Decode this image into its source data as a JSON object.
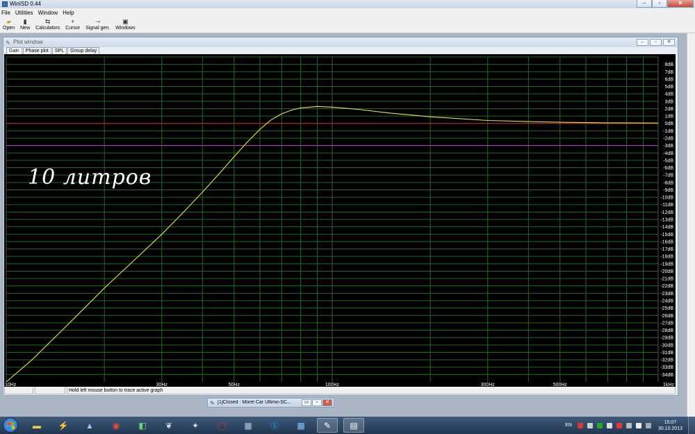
{
  "app": {
    "title": "WinISD 0.44"
  },
  "menu": [
    "File",
    "Utilities",
    "Window",
    "Help"
  ],
  "toolbar": [
    {
      "icon": "open-icon",
      "label": "Open"
    },
    {
      "icon": "new-icon",
      "label": "New"
    },
    {
      "icon": "calculators-icon",
      "label": "Calculators"
    },
    {
      "icon": "cursor-icon",
      "label": "Cursor"
    },
    {
      "icon": "signal-gen-icon",
      "label": "Signal gen."
    },
    {
      "icon": "windows-icon",
      "label": "Windows"
    }
  ],
  "plot_window": {
    "title": "Plot window",
    "tabs": [
      "Gain",
      "Phase plot",
      "SPL",
      "Group delay"
    ],
    "active_tab": "Gain",
    "annotation": "10 литров",
    "status": "Hold left mouse button to trace active graph"
  },
  "minimized_window": {
    "title": "[1]Closed : Morel Car Ultimo-SC..."
  },
  "taskbar": {
    "icons": [
      "explorer",
      "winamp",
      "xilisoft",
      "chrome",
      "corel",
      "bird",
      "fox",
      "opera",
      "installer",
      "skype",
      "controlpanel",
      "winisd",
      "props"
    ],
    "active_icon": "winisd",
    "language": "EN",
    "time": "15:07",
    "date": "30.10.2013"
  },
  "colors": {
    "grid_green": "#1f6a1f",
    "grid_gray": "#555555",
    "curve": "#e6e64a",
    "zero_line": "#d02020",
    "minus3_line": "#b040c0",
    "tick_text": "#ffffff"
  },
  "chart_data": {
    "type": "line",
    "title": "",
    "xlabel": "",
    "ylabel": "",
    "x_scale": "log",
    "xlim": [
      10,
      1000
    ],
    "ylim": [
      -35,
      9
    ],
    "grid": true,
    "x_tick_labels": [
      {
        "x": 10,
        "label": "10Hz"
      },
      {
        "x": 30,
        "label": "30Hz"
      },
      {
        "x": 50,
        "label": "50Hz"
      },
      {
        "x": 100,
        "label": "100Hz"
      },
      {
        "x": 300,
        "label": "300Hz"
      },
      {
        "x": 500,
        "label": "500Hz"
      },
      {
        "x": 1000,
        "label": "1kHz"
      }
    ],
    "y_ticks": [
      8,
      7,
      6,
      5,
      4,
      3,
      2,
      1,
      0,
      -1,
      -2,
      -3,
      -4,
      -5,
      -6,
      -7,
      -8,
      -9,
      -10,
      -11,
      -12,
      -13,
      -14,
      -15,
      -16,
      -17,
      -18,
      -19,
      -20,
      -21,
      -22,
      -23,
      -24,
      -25,
      -26,
      -27,
      -28,
      -29,
      -30,
      -31,
      -32,
      -33,
      -34
    ],
    "y_tick_suffix": "dB",
    "reference_lines": [
      {
        "y": 0,
        "color": "#d02020"
      },
      {
        "y": -3,
        "color": "#b040c0"
      }
    ],
    "series": [
      {
        "color": "#e6e64a",
        "points": [
          [
            10,
            -35
          ],
          [
            12,
            -32
          ],
          [
            15,
            -27.8
          ],
          [
            20,
            -22.3
          ],
          [
            25,
            -18.3
          ],
          [
            30,
            -15
          ],
          [
            35,
            -12
          ],
          [
            40,
            -9.3
          ],
          [
            45,
            -6.8
          ],
          [
            50,
            -4.5
          ],
          [
            55,
            -2.5
          ],
          [
            60,
            -0.8
          ],
          [
            65,
            0.5
          ],
          [
            70,
            1.3
          ],
          [
            75,
            1.8
          ],
          [
            80,
            2.1
          ],
          [
            90,
            2.3
          ],
          [
            100,
            2.2
          ],
          [
            120,
            1.9
          ],
          [
            150,
            1.4
          ],
          [
            200,
            0.9
          ],
          [
            300,
            0.4
          ],
          [
            400,
            0.25
          ],
          [
            500,
            0.15
          ],
          [
            700,
            0.08
          ],
          [
            1000,
            0.05
          ]
        ]
      }
    ]
  }
}
